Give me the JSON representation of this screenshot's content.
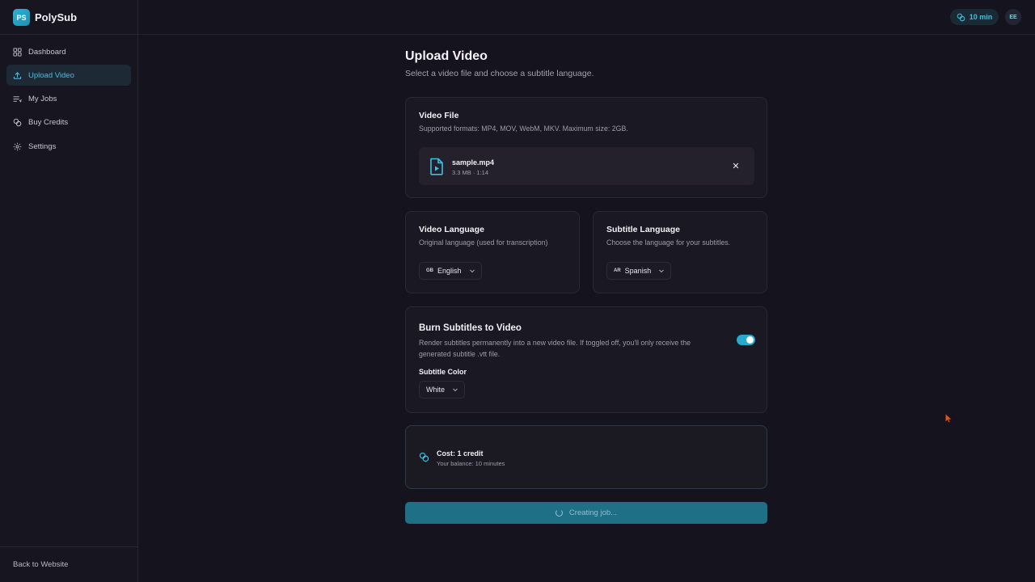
{
  "brand": {
    "logo_text": "PS",
    "name": "PolySub"
  },
  "sidebar": {
    "items": [
      {
        "label": "Dashboard",
        "icon": "grid-icon",
        "active": false
      },
      {
        "label": "Upload Video",
        "icon": "upload-icon",
        "active": true
      },
      {
        "label": "My Jobs",
        "icon": "list-icon",
        "active": false
      },
      {
        "label": "Buy Credits",
        "icon": "coins-icon",
        "active": false
      },
      {
        "label": "Settings",
        "icon": "gear-icon",
        "active": false
      }
    ],
    "back_link": "Back to Website"
  },
  "header": {
    "credits": "10 min",
    "avatar_initials": "EE"
  },
  "page": {
    "title": "Upload Video",
    "subtitle": "Select a video file and choose a subtitle language."
  },
  "video_file": {
    "title": "Video File",
    "description": "Supported formats: MP4, MOV, WebM, MKV. Maximum size: 2GB.",
    "file_name": "sample.mp4",
    "file_meta": "3.3 MB · 1:14"
  },
  "video_language": {
    "title": "Video Language",
    "description": "Original language (used for transcription)",
    "flag": "GB",
    "selected": "English"
  },
  "subtitle_language": {
    "title": "Subtitle Language",
    "description": "Choose the language for your subtitles.",
    "flag": "AR",
    "selected": "Spanish"
  },
  "burn": {
    "title": "Burn Subtitles to Video",
    "description": "Render subtitles permanently into a new video file. If toggled off, you'll only receive the generated subtitle .vtt file.",
    "toggle_on": true,
    "color_label": "Subtitle Color",
    "color_selected": "White"
  },
  "cost": {
    "title": "Cost: 1 credit",
    "balance": "Your balance: 10 minutes"
  },
  "submit": {
    "label": "Creating job..."
  },
  "colors": {
    "accent": "#3ec0e3",
    "background": "#15131d",
    "card": "#1a1822"
  }
}
